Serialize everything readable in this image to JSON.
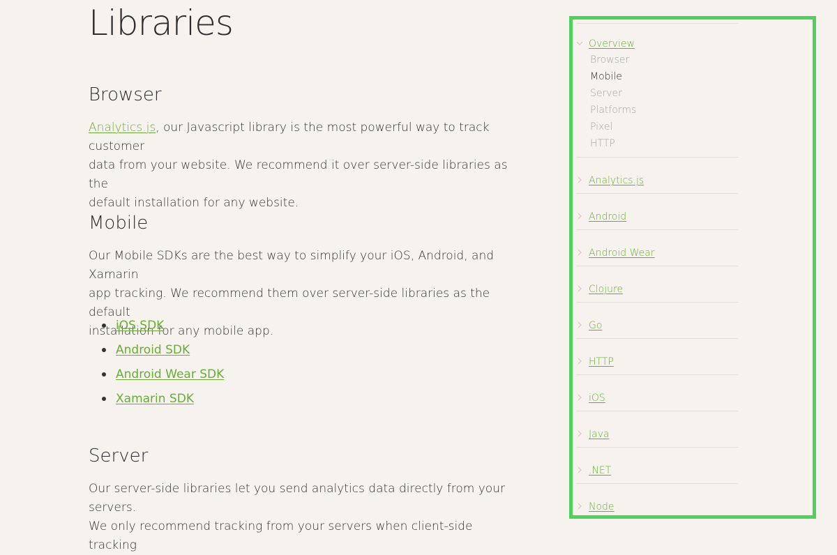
{
  "main": {
    "title": "Libraries",
    "sections": {
      "browser": {
        "heading": "Browser",
        "link": "Analytics.js",
        "text_line1": ", our Javascript library is the most powerful way to track customer",
        "text_line2": "data from your website. We recommend it over server-side libraries as the",
        "text_line3": "default installation for any website."
      },
      "mobile": {
        "heading": "Mobile",
        "text_line1": "Our Mobile SDKs are the best way to simplify your iOS, Android, and Xamarin",
        "text_line2": "app tracking. We recommend them over server-side libraries as the default",
        "text_line3": "installation for any mobile app.",
        "links": [
          "iOS SDK",
          "Android SDK",
          "Android Wear SDK",
          "Xamarin SDK"
        ]
      },
      "server": {
        "heading": "Server",
        "text_line1": "Our server-side libraries let you send analytics data directly from your servers.",
        "text_line2": "We only recommend tracking from your servers when client-side tracking"
      }
    }
  },
  "sidebar": {
    "overview": {
      "label": "Overview",
      "items": [
        "Browser",
        "Mobile",
        "Server",
        "Platforms",
        "Pixel",
        "HTTP"
      ],
      "active": "Mobile"
    },
    "groups": [
      "Analytics.js",
      "Android",
      "Android Wear",
      "Clojure",
      "Go",
      "HTTP",
      "iOS",
      "Java",
      ".NET",
      "Node"
    ],
    "highlight_color": "#4fd15b",
    "link_color": "#6aaa37"
  }
}
